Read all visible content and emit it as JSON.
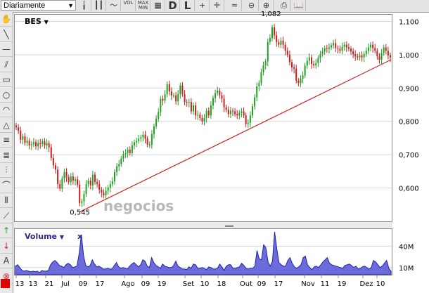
{
  "toolbar": {
    "period_label": "Diariamente",
    "buttons": [
      {
        "name": "bar-chart-icon",
        "glyph": "╽"
      },
      {
        "name": "candlestick-icon",
        "glyph": "┃┃"
      },
      {
        "name": "line-chart-icon",
        "glyph": "〜"
      },
      {
        "name": "volume-toggle",
        "text": "VOL"
      },
      {
        "name": "max-min-toggle",
        "text": "MAX MIN"
      },
      {
        "name": "grid-icon",
        "glyph": "▦"
      },
      {
        "name": "dark-mode-button",
        "text": "D"
      },
      {
        "name": "log-scale-button",
        "text": "L"
      },
      {
        "name": "crosshair-icon",
        "glyph": "+"
      },
      {
        "name": "cursor-crosshair-icon",
        "glyph": "✛"
      },
      {
        "name": "wave-icon",
        "glyph": "≈"
      },
      {
        "name": "zoom-out-icon",
        "glyph": "⊖"
      },
      {
        "name": "zoom-in-icon",
        "glyph": "⊕"
      },
      {
        "name": "print-icon",
        "glyph": "⎙"
      },
      {
        "name": "book-icon",
        "glyph": "📖"
      }
    ]
  },
  "left_tools": [
    "hand-icon",
    "line-tool-icon",
    "horizontal-line-icon",
    "parallel-lines-icon",
    "rectangle-icon",
    "circle-icon",
    "arc-icon",
    "triangle-icon",
    "fibonacci-icon",
    "retracement-icon",
    "speed-lines-icon",
    "arc-fan-icon",
    "time-zones-icon",
    "fan-lines-icon",
    "buy-arrow-icon",
    "sell-arrow-icon",
    "text-tool-icon",
    "delete-icon"
  ],
  "ticker": "BES",
  "volume_header": {
    "label": "Volume",
    "close": "x"
  },
  "watermark": "negocios",
  "colors": {
    "up": "#22a022",
    "down": "#c81e1e",
    "trend": "#d42020",
    "volume_fill": "#6b6bdc",
    "volume_stroke": "#2222aa",
    "grid": "#d8d8d8"
  },
  "chart_data": {
    "type": "candlestick",
    "series": [
      {
        "name": "BES",
        "unit": "EUR"
      }
    ],
    "ylim": [
      0.5,
      1.12
    ],
    "yticks": [
      "0,600",
      "0,700",
      "0,800",
      "0,900",
      "1,000",
      "1,100"
    ],
    "yticks_values": [
      0.6,
      0.7,
      0.8,
      0.9,
      1.0,
      1.1
    ],
    "xticks": [
      "13",
      "13",
      "21",
      "Jul",
      "09",
      "17",
      "Ago",
      "09",
      "19",
      "Set",
      "10",
      "18",
      "Out",
      "09",
      "17",
      "Nov",
      "11",
      "19",
      "Dez",
      "10"
    ],
    "annotations": [
      {
        "text": "0,545",
        "value": 0.545
      },
      {
        "text": "1,082",
        "value": 1.082
      }
    ],
    "trendline": {
      "from": 0.528,
      "to": 0.985
    },
    "closes": [
      0.782,
      0.772,
      0.745,
      0.755,
      0.735,
      0.742,
      0.728,
      0.731,
      0.738,
      0.725,
      0.735,
      0.732,
      0.74,
      0.728,
      0.735,
      0.722,
      0.69,
      0.668,
      0.655,
      0.612,
      0.598,
      0.628,
      0.648,
      0.632,
      0.618,
      0.635,
      0.622,
      0.626,
      0.61,
      0.555,
      0.56,
      0.582,
      0.612,
      0.622,
      0.608,
      0.64,
      0.618,
      0.612,
      0.595,
      0.586,
      0.578,
      0.592,
      0.601,
      0.612,
      0.62,
      0.648,
      0.665,
      0.672,
      0.688,
      0.702,
      0.705,
      0.715,
      0.705,
      0.728,
      0.737,
      0.741,
      0.748,
      0.752,
      0.76,
      0.748,
      0.73,
      0.73,
      0.762,
      0.785,
      0.808,
      0.828,
      0.868,
      0.862,
      0.882,
      0.912,
      0.89,
      0.878,
      0.878,
      0.86,
      0.882,
      0.908,
      0.882,
      0.858,
      0.856,
      0.858,
      0.83,
      0.848,
      0.818,
      0.82,
      0.81,
      0.8,
      0.81,
      0.832,
      0.818,
      0.848,
      0.87,
      0.885,
      0.892,
      0.878,
      0.868,
      0.842,
      0.835,
      0.822,
      0.832,
      0.83,
      0.822,
      0.818,
      0.826,
      0.83,
      0.818,
      0.792,
      0.796,
      0.818,
      0.845,
      0.872,
      0.905,
      0.915,
      0.948,
      0.968,
      0.98,
      1.038,
      1.05,
      1.082,
      1.058,
      1.038,
      1.03,
      1.042,
      1.03,
      1.012,
      1.0,
      0.978,
      0.962,
      0.958,
      0.922,
      0.915,
      0.928,
      0.938,
      0.968,
      0.982,
      0.992,
      0.972,
      0.968,
      0.975,
      0.99,
      1.002,
      1.01,
      1.02,
      1.018,
      1.022,
      1.028,
      1.035,
      1.02,
      1.018,
      1.012,
      1.024,
      1.03,
      1.022,
      1.018,
      1.01,
      1.002,
      0.995,
      0.992,
      0.998,
      0.992,
      1.002,
      1.012,
      1.022,
      1.03,
      1.02,
      1.012,
      0.995,
      0.985,
      1.005,
      1.022,
      1.012,
      0.998,
      0.992
    ],
    "volume": {
      "unit": "M",
      "ylim": [
        0,
        62
      ],
      "yticks": [
        "10M",
        "40M"
      ],
      "yticks_values": [
        10,
        40
      ],
      "values": [
        12,
        14,
        10,
        6,
        5,
        6,
        5,
        4,
        5,
        4,
        5,
        3,
        6,
        5,
        5,
        6,
        14,
        18,
        20,
        17,
        13,
        12,
        10,
        14,
        16,
        14,
        10,
        11,
        12,
        30,
        56,
        27,
        13,
        11,
        13,
        21,
        15,
        11,
        12,
        10,
        8,
        8,
        9,
        8,
        8,
        13,
        17,
        11,
        9,
        10,
        9,
        8,
        12,
        15,
        17,
        14,
        11,
        14,
        21,
        19,
        12,
        10,
        24,
        17,
        13,
        11,
        9,
        15,
        12,
        11,
        10,
        10,
        13,
        19,
        12,
        10,
        8,
        8,
        7,
        11,
        9,
        15,
        14,
        9,
        9,
        10,
        9,
        7,
        11,
        10,
        8,
        8,
        9,
        15,
        11,
        6,
        12,
        14,
        14,
        9,
        9,
        10,
        11,
        16,
        13,
        9,
        8,
        9,
        9,
        12,
        34,
        22,
        21,
        42,
        38,
        18,
        12,
        19,
        60,
        36,
        17,
        14,
        12,
        12,
        20,
        24,
        16,
        11,
        9,
        11,
        14,
        24,
        26,
        14,
        10,
        7,
        11,
        12,
        10,
        14,
        18,
        21,
        24,
        16,
        14,
        13,
        12,
        11,
        10,
        9,
        13,
        14,
        15,
        13,
        10,
        12,
        8,
        9,
        11,
        12,
        10,
        8,
        10,
        20,
        18,
        14,
        10,
        12,
        16,
        20,
        9,
        5
      ]
    }
  }
}
